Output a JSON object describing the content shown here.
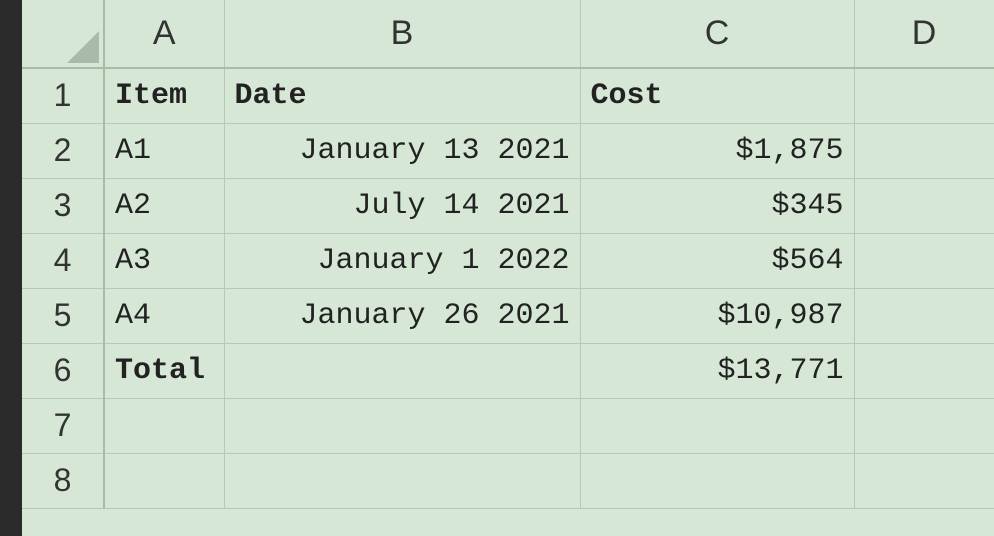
{
  "columnHeaders": {
    "A": "A",
    "B": "B",
    "C": "C",
    "D": "D"
  },
  "rowHeaders": [
    "1",
    "2",
    "3",
    "4",
    "5",
    "6",
    "7",
    "8"
  ],
  "cells": {
    "A1": "Item",
    "B1": "Date",
    "C1": "Cost",
    "A2": "A1",
    "B2": "January 13 2021",
    "C2": "$1,875",
    "A3": "A2",
    "B3": "July 14 2021",
    "C3": "$345",
    "A4": "A3",
    "B4": "January 1 2022",
    "C4": "$564",
    "A5": "A4",
    "B5": "January 26 2021",
    "C5": "$10,987",
    "A6": "Total",
    "B6": "",
    "C6": "$13,771",
    "A7": "",
    "B7": "",
    "C7": "",
    "A8": "",
    "B8": "",
    "C8": ""
  },
  "chart_data": {
    "type": "table",
    "title": "",
    "headers": [
      "Item",
      "Date",
      "Cost"
    ],
    "rows": [
      {
        "Item": "A1",
        "Date": "January 13 2021",
        "Cost": 1875
      },
      {
        "Item": "A2",
        "Date": "July 14 2021",
        "Cost": 345
      },
      {
        "Item": "A3",
        "Date": "January 1 2022",
        "Cost": 564
      },
      {
        "Item": "A4",
        "Date": "January 26 2021",
        "Cost": 10987
      }
    ],
    "total": {
      "Cost": 13771
    }
  }
}
